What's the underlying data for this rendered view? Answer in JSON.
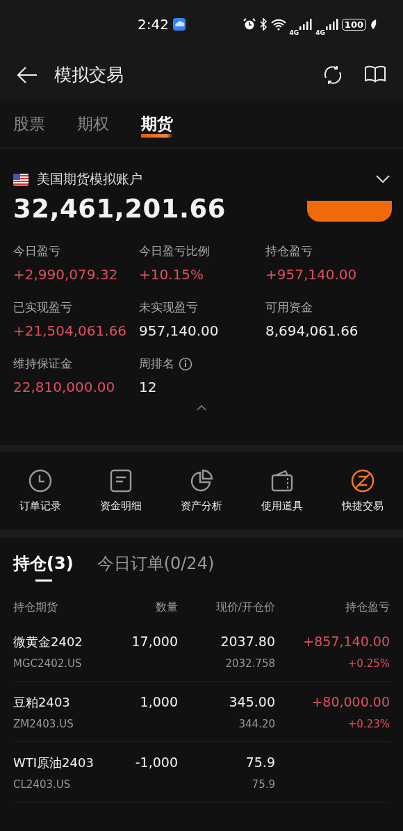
{
  "status_bar": {
    "time": "2:42",
    "networks": [
      "4G",
      "4G"
    ],
    "battery": "100"
  },
  "header": {
    "title": "模拟交易"
  },
  "tabs": [
    {
      "label": "股票",
      "selected": false
    },
    {
      "label": "期权",
      "selected": false
    },
    {
      "label": "期货",
      "selected": true
    }
  ],
  "account": {
    "name": "美国期货模拟账户",
    "total": "32,461,201.66",
    "metrics": [
      {
        "label": "今日盈亏",
        "value": "+2,990,079.32",
        "kind": "gain",
        "info": false
      },
      {
        "label": "今日盈亏比例",
        "value": "+10.15%",
        "kind": "gain",
        "info": false
      },
      {
        "label": "持仓盈亏",
        "value": "+957,140.00",
        "kind": "gain",
        "info": false
      },
      {
        "label": "已实现盈亏",
        "value": "+21,504,061.66",
        "kind": "gain",
        "info": false
      },
      {
        "label": "未实现盈亏",
        "value": "957,140.00",
        "kind": "plain",
        "info": false
      },
      {
        "label": "可用资金",
        "value": "8,694,061.66",
        "kind": "plain",
        "info": false
      },
      {
        "label": "维持保证金",
        "value": "22,810,000.00",
        "kind": "gain",
        "info": false
      },
      {
        "label": "周排名",
        "value": "12",
        "kind": "plain",
        "info": true
      }
    ]
  },
  "tools": [
    {
      "label": "订单记录",
      "kind": "clock",
      "accent": false
    },
    {
      "label": "资金明细",
      "kind": "document",
      "accent": false
    },
    {
      "label": "资产分析",
      "kind": "pie",
      "accent": false
    },
    {
      "label": "使用道具",
      "kind": "wallet",
      "accent": false
    },
    {
      "label": "快捷交易",
      "kind": "quick",
      "accent": true
    }
  ],
  "positions": {
    "tabs": [
      {
        "label": "持仓(3)",
        "selected": true
      },
      {
        "label": "今日订单(0/24)",
        "selected": false
      }
    ],
    "columns": [
      "持仓期货",
      "数量",
      "现价/开仓价",
      "持仓盈亏"
    ],
    "rows": [
      {
        "name": "微黄金2402",
        "code": "MGC2402.US",
        "quantity": "17,000",
        "price": "2037.80",
        "open_price": "2032.758",
        "pnl": "+857,140.00",
        "pnl_ratio": "+0.25%"
      },
      {
        "name": "豆粕2403",
        "code": "ZM2403.US",
        "quantity": "1,000",
        "price": "345.00",
        "open_price": "344.20",
        "pnl": "+80,000.00",
        "pnl_ratio": "+0.23%"
      },
      {
        "name": "WTI原油2403",
        "code": "CL2403.US",
        "quantity": "-1,000",
        "price": "75.9",
        "open_price": "75.9"
      }
    ]
  }
}
